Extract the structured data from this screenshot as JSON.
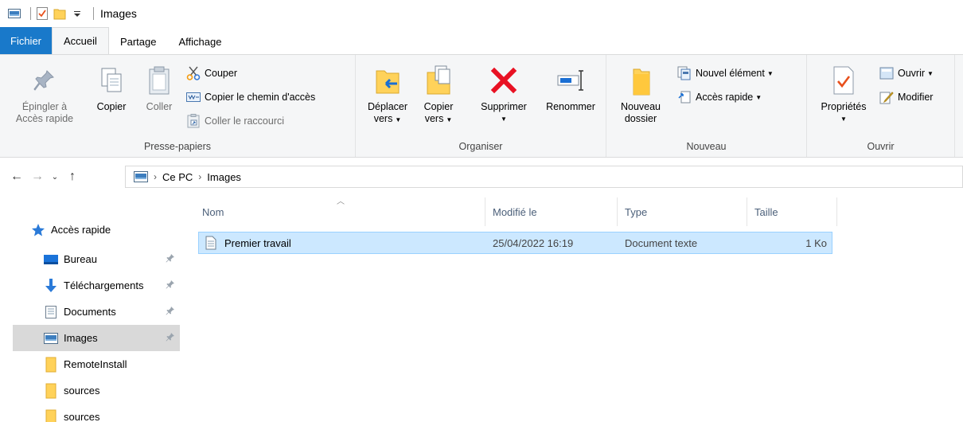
{
  "window": {
    "title": "Images"
  },
  "tabs": {
    "file": "Fichier",
    "home": "Accueil",
    "share": "Partage",
    "view": "Affichage"
  },
  "ribbon": {
    "clipboard": {
      "label": "Presse-papiers",
      "pin_line1": "Épingler à",
      "pin_line2": "Accès rapide",
      "copy": "Copier",
      "paste": "Coller",
      "cut": "Couper",
      "copy_path": "Copier le chemin d'accès",
      "paste_shortcut": "Coller le raccourci"
    },
    "organize": {
      "label": "Organiser",
      "move_line1": "Déplacer",
      "move_line2": "vers",
      "copyto_line1": "Copier",
      "copyto_line2": "vers",
      "delete": "Supprimer",
      "rename": "Renommer"
    },
    "new": {
      "label": "Nouveau",
      "new_folder_line1": "Nouveau",
      "new_folder_line2": "dossier",
      "new_item": "Nouvel élément",
      "easy_access": "Accès rapide"
    },
    "open": {
      "label": "Ouvrir",
      "properties": "Propriétés",
      "open": "Ouvrir",
      "edit": "Modifier"
    }
  },
  "address": {
    "crumbs": [
      "Ce PC",
      "Images"
    ]
  },
  "navpane": {
    "quick_access": "Accès rapide",
    "items": [
      {
        "label": "Bureau",
        "pinned": true
      },
      {
        "label": "Téléchargements",
        "pinned": true
      },
      {
        "label": "Documents",
        "pinned": true
      },
      {
        "label": "Images",
        "pinned": true,
        "selected": true
      },
      {
        "label": "RemoteInstall",
        "pinned": false
      },
      {
        "label": "sources",
        "pinned": false
      },
      {
        "label": "sources",
        "pinned": false
      }
    ]
  },
  "list": {
    "columns": [
      "Nom",
      "Modifié le",
      "Type",
      "Taille"
    ],
    "rows": [
      {
        "name": "Premier travail",
        "modified": "25/04/2022 16:19",
        "type": "Document texte",
        "size": "1 Ko"
      }
    ]
  },
  "colors": {
    "file_tab": "#1979ca",
    "selection": "#cce8ff",
    "selection_border": "#99d1ff",
    "delete_red": "#e81123",
    "folder_yellow": "#ffd25a"
  }
}
